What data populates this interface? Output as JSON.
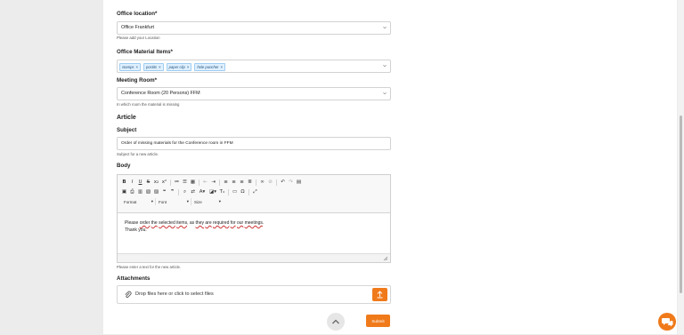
{
  "office_location": {
    "label": "Office location*",
    "value": "Office Frankfurt",
    "help": "Please add your Location"
  },
  "office_material": {
    "label": "Office Material Items*",
    "tags": [
      "stamps",
      "postits",
      "paper clip",
      "hole puncher"
    ]
  },
  "meeting_room": {
    "label": "Meeting Room*",
    "value": "Conference Room (20 Persons) FFM",
    "help": "In which room the material is missing"
  },
  "article": {
    "heading": "Article",
    "subject_label": "Subject",
    "subject_value": "Order of missing materials for the Conference room in FFM",
    "subject_help": "Subject for a new article.",
    "body_label": "Body",
    "body_line1_a": "Please ",
    "body_line1_b": "order",
    "body_line1_c": " ",
    "body_line1_d": "the",
    "body_line1_e": " ",
    "body_line1_f": "selected",
    "body_line1_g": " ",
    "body_line1_h": "items",
    "body_line1_i": ", as ",
    "body_line1_j": "they",
    "body_line1_k": " ",
    "body_line1_l": "are",
    "body_line1_m": " ",
    "body_line1_n": "required",
    "body_line1_o": " ",
    "body_line1_p": "for",
    "body_line1_q": " ",
    "body_line1_r": "our",
    "body_line1_s": " ",
    "body_line1_t": "meetings",
    "body_line1_u": ".",
    "body_line2": "Thank you.",
    "body_help": "Please enter a text for the new article."
  },
  "editor": {
    "format_label": "Format",
    "font_label": "Font",
    "size_label": "Size"
  },
  "attachments": {
    "label": "Attachments",
    "drop_text": "Drop files here or click to select files"
  },
  "submit_label": "Submit",
  "colors": {
    "accent": "#f07a1a",
    "tag_bg": "#dff0ff"
  }
}
